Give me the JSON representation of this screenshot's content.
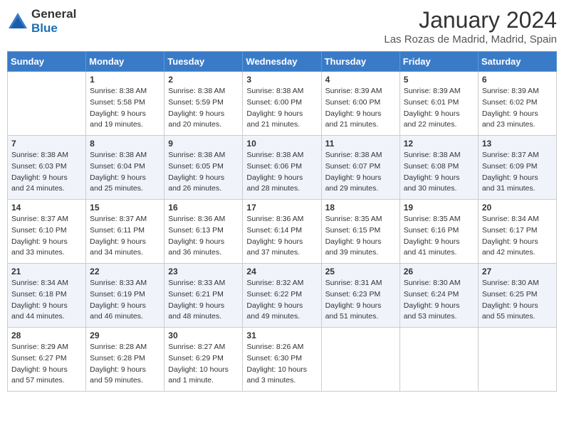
{
  "logo": {
    "general": "General",
    "blue": "Blue"
  },
  "title": "January 2024",
  "location": "Las Rozas de Madrid, Madrid, Spain",
  "headers": [
    "Sunday",
    "Monday",
    "Tuesday",
    "Wednesday",
    "Thursday",
    "Friday",
    "Saturday"
  ],
  "weeks": [
    [
      {
        "day": "",
        "sunrise": "",
        "sunset": "",
        "daylight": ""
      },
      {
        "day": "1",
        "sunrise": "Sunrise: 8:38 AM",
        "sunset": "Sunset: 5:58 PM",
        "daylight": "Daylight: 9 hours and 19 minutes."
      },
      {
        "day": "2",
        "sunrise": "Sunrise: 8:38 AM",
        "sunset": "Sunset: 5:59 PM",
        "daylight": "Daylight: 9 hours and 20 minutes."
      },
      {
        "day": "3",
        "sunrise": "Sunrise: 8:38 AM",
        "sunset": "Sunset: 6:00 PM",
        "daylight": "Daylight: 9 hours and 21 minutes."
      },
      {
        "day": "4",
        "sunrise": "Sunrise: 8:39 AM",
        "sunset": "Sunset: 6:00 PM",
        "daylight": "Daylight: 9 hours and 21 minutes."
      },
      {
        "day": "5",
        "sunrise": "Sunrise: 8:39 AM",
        "sunset": "Sunset: 6:01 PM",
        "daylight": "Daylight: 9 hours and 22 minutes."
      },
      {
        "day": "6",
        "sunrise": "Sunrise: 8:39 AM",
        "sunset": "Sunset: 6:02 PM",
        "daylight": "Daylight: 9 hours and 23 minutes."
      }
    ],
    [
      {
        "day": "7",
        "sunrise": "Sunrise: 8:38 AM",
        "sunset": "Sunset: 6:03 PM",
        "daylight": "Daylight: 9 hours and 24 minutes."
      },
      {
        "day": "8",
        "sunrise": "Sunrise: 8:38 AM",
        "sunset": "Sunset: 6:04 PM",
        "daylight": "Daylight: 9 hours and 25 minutes."
      },
      {
        "day": "9",
        "sunrise": "Sunrise: 8:38 AM",
        "sunset": "Sunset: 6:05 PM",
        "daylight": "Daylight: 9 hours and 26 minutes."
      },
      {
        "day": "10",
        "sunrise": "Sunrise: 8:38 AM",
        "sunset": "Sunset: 6:06 PM",
        "daylight": "Daylight: 9 hours and 28 minutes."
      },
      {
        "day": "11",
        "sunrise": "Sunrise: 8:38 AM",
        "sunset": "Sunset: 6:07 PM",
        "daylight": "Daylight: 9 hours and 29 minutes."
      },
      {
        "day": "12",
        "sunrise": "Sunrise: 8:38 AM",
        "sunset": "Sunset: 6:08 PM",
        "daylight": "Daylight: 9 hours and 30 minutes."
      },
      {
        "day": "13",
        "sunrise": "Sunrise: 8:37 AM",
        "sunset": "Sunset: 6:09 PM",
        "daylight": "Daylight: 9 hours and 31 minutes."
      }
    ],
    [
      {
        "day": "14",
        "sunrise": "Sunrise: 8:37 AM",
        "sunset": "Sunset: 6:10 PM",
        "daylight": "Daylight: 9 hours and 33 minutes."
      },
      {
        "day": "15",
        "sunrise": "Sunrise: 8:37 AM",
        "sunset": "Sunset: 6:11 PM",
        "daylight": "Daylight: 9 hours and 34 minutes."
      },
      {
        "day": "16",
        "sunrise": "Sunrise: 8:36 AM",
        "sunset": "Sunset: 6:13 PM",
        "daylight": "Daylight: 9 hours and 36 minutes."
      },
      {
        "day": "17",
        "sunrise": "Sunrise: 8:36 AM",
        "sunset": "Sunset: 6:14 PM",
        "daylight": "Daylight: 9 hours and 37 minutes."
      },
      {
        "day": "18",
        "sunrise": "Sunrise: 8:35 AM",
        "sunset": "Sunset: 6:15 PM",
        "daylight": "Daylight: 9 hours and 39 minutes."
      },
      {
        "day": "19",
        "sunrise": "Sunrise: 8:35 AM",
        "sunset": "Sunset: 6:16 PM",
        "daylight": "Daylight: 9 hours and 41 minutes."
      },
      {
        "day": "20",
        "sunrise": "Sunrise: 8:34 AM",
        "sunset": "Sunset: 6:17 PM",
        "daylight": "Daylight: 9 hours and 42 minutes."
      }
    ],
    [
      {
        "day": "21",
        "sunrise": "Sunrise: 8:34 AM",
        "sunset": "Sunset: 6:18 PM",
        "daylight": "Daylight: 9 hours and 44 minutes."
      },
      {
        "day": "22",
        "sunrise": "Sunrise: 8:33 AM",
        "sunset": "Sunset: 6:19 PM",
        "daylight": "Daylight: 9 hours and 46 minutes."
      },
      {
        "day": "23",
        "sunrise": "Sunrise: 8:33 AM",
        "sunset": "Sunset: 6:21 PM",
        "daylight": "Daylight: 9 hours and 48 minutes."
      },
      {
        "day": "24",
        "sunrise": "Sunrise: 8:32 AM",
        "sunset": "Sunset: 6:22 PM",
        "daylight": "Daylight: 9 hours and 49 minutes."
      },
      {
        "day": "25",
        "sunrise": "Sunrise: 8:31 AM",
        "sunset": "Sunset: 6:23 PM",
        "daylight": "Daylight: 9 hours and 51 minutes."
      },
      {
        "day": "26",
        "sunrise": "Sunrise: 8:30 AM",
        "sunset": "Sunset: 6:24 PM",
        "daylight": "Daylight: 9 hours and 53 minutes."
      },
      {
        "day": "27",
        "sunrise": "Sunrise: 8:30 AM",
        "sunset": "Sunset: 6:25 PM",
        "daylight": "Daylight: 9 hours and 55 minutes."
      }
    ],
    [
      {
        "day": "28",
        "sunrise": "Sunrise: 8:29 AM",
        "sunset": "Sunset: 6:27 PM",
        "daylight": "Daylight: 9 hours and 57 minutes."
      },
      {
        "day": "29",
        "sunrise": "Sunrise: 8:28 AM",
        "sunset": "Sunset: 6:28 PM",
        "daylight": "Daylight: 9 hours and 59 minutes."
      },
      {
        "day": "30",
        "sunrise": "Sunrise: 8:27 AM",
        "sunset": "Sunset: 6:29 PM",
        "daylight": "Daylight: 10 hours and 1 minute."
      },
      {
        "day": "31",
        "sunrise": "Sunrise: 8:26 AM",
        "sunset": "Sunset: 6:30 PM",
        "daylight": "Daylight: 10 hours and 3 minutes."
      },
      {
        "day": "",
        "sunrise": "",
        "sunset": "",
        "daylight": ""
      },
      {
        "day": "",
        "sunrise": "",
        "sunset": "",
        "daylight": ""
      },
      {
        "day": "",
        "sunrise": "",
        "sunset": "",
        "daylight": ""
      }
    ]
  ]
}
